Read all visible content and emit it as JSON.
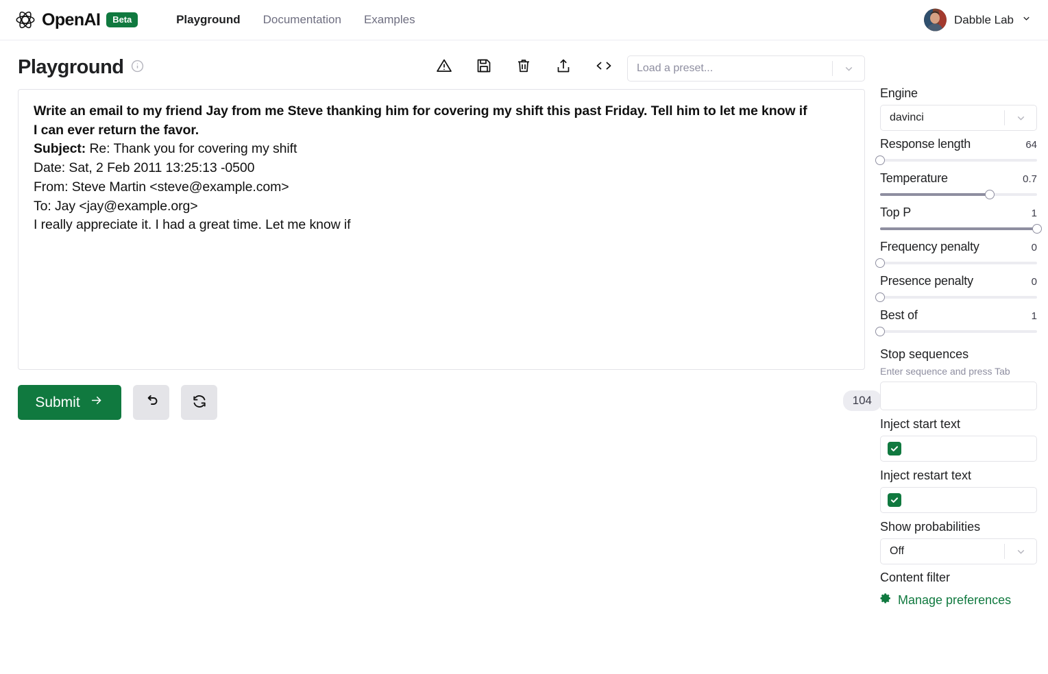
{
  "brand": {
    "name": "OpenAI",
    "badge": "Beta",
    "logo_icon": "openai-logo-icon"
  },
  "nav": {
    "items": [
      {
        "label": "Playground",
        "active": true
      },
      {
        "label": "Documentation",
        "active": false
      },
      {
        "label": "Examples",
        "active": false
      }
    ]
  },
  "user": {
    "name": "Dabble Lab",
    "avatar_alt": "user-avatar",
    "caret_icon": "chevron-down-icon"
  },
  "page": {
    "title": "Playground",
    "info_icon": "info-circle-icon"
  },
  "toolbar": {
    "icons": [
      {
        "name": "warning-triangle-icon",
        "title": "Warning"
      },
      {
        "name": "save-icon",
        "title": "Save"
      },
      {
        "name": "trash-icon",
        "title": "Delete"
      },
      {
        "name": "share-icon",
        "title": "Share"
      },
      {
        "name": "code-icon",
        "title": "View code"
      }
    ]
  },
  "preset": {
    "placeholder": "Load a preset...",
    "value": "",
    "caret_icon": "chevron-down-icon"
  },
  "editor": {
    "prompt": "Write an email to my friend Jay from me Steve thanking him for covering my shift this past Friday. Tell him to let me know if\nI can ever return the favor.",
    "completion_label": "Subject:",
    "completion_head": " Re: Thank you for covering my shift",
    "completion_body": "Date: Sat, 2 Feb 2011 13:25:13 -0500\nFrom: Steve Martin <steve@example.com>\nTo: Jay <jay@example.org>\nI really appreciate it. I had a great time. Let me know if"
  },
  "actions": {
    "submit_label": "Submit",
    "submit_arrow": "arrow-right-icon",
    "undo_icon": "undo-icon",
    "regenerate_icon": "regenerate-icon",
    "token_count": "104"
  },
  "sidebar": {
    "engine_label": "Engine",
    "engine_value": "davinci",
    "sliders": [
      {
        "label": "Response length",
        "value": "64",
        "pct": 0
      },
      {
        "label": "Temperature",
        "value": "0.7",
        "pct": 70
      },
      {
        "label": "Top P",
        "value": "1",
        "pct": 100
      },
      {
        "label": "Frequency penalty",
        "value": "0",
        "pct": 0
      },
      {
        "label": "Presence penalty",
        "value": "0",
        "pct": 0
      },
      {
        "label": "Best of",
        "value": "1",
        "pct": 0
      }
    ],
    "stop_label": "Stop sequences",
    "stop_hint": "Enter sequence and press Tab",
    "stop_value": "",
    "inject_start_label": "Inject start text",
    "inject_start_checked": true,
    "inject_restart_label": "Inject restart text",
    "inject_restart_checked": true,
    "show_prob_label": "Show probabilities",
    "show_prob_value": "Off",
    "content_filter_label": "Content filter",
    "manage_label": "Manage preferences",
    "manage_icon": "gear-icon"
  },
  "colors": {
    "brand_green": "#10793f",
    "accent_gray": "#8e8ea0",
    "track": "#ececf1"
  }
}
